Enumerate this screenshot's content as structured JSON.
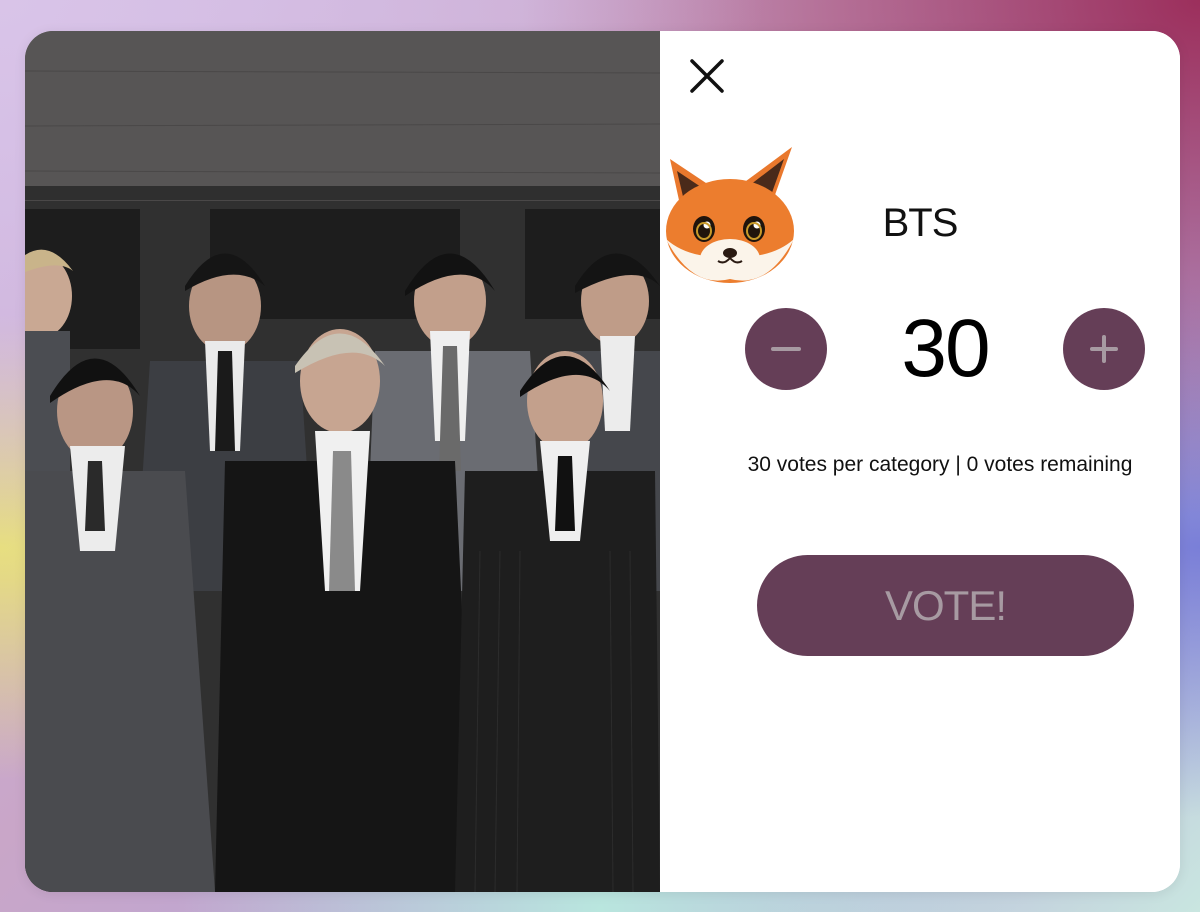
{
  "dialog": {
    "artist_name": "BTS",
    "vote_count": "30",
    "votes_info": "30 votes per category | 0 votes remaining",
    "vote_button_label": "VOTE!",
    "decrement_symbol": "−",
    "increment_symbol": "+"
  },
  "icons": {
    "close": "close-icon",
    "avatar": "fox-avatar-icon",
    "minus": "minus-icon",
    "plus": "plus-icon"
  },
  "colors": {
    "accent": "#653e57",
    "vote_label": "#a79aa2",
    "stepper_symbol": "#a79aa2",
    "panel_bg": "#ffffff"
  }
}
